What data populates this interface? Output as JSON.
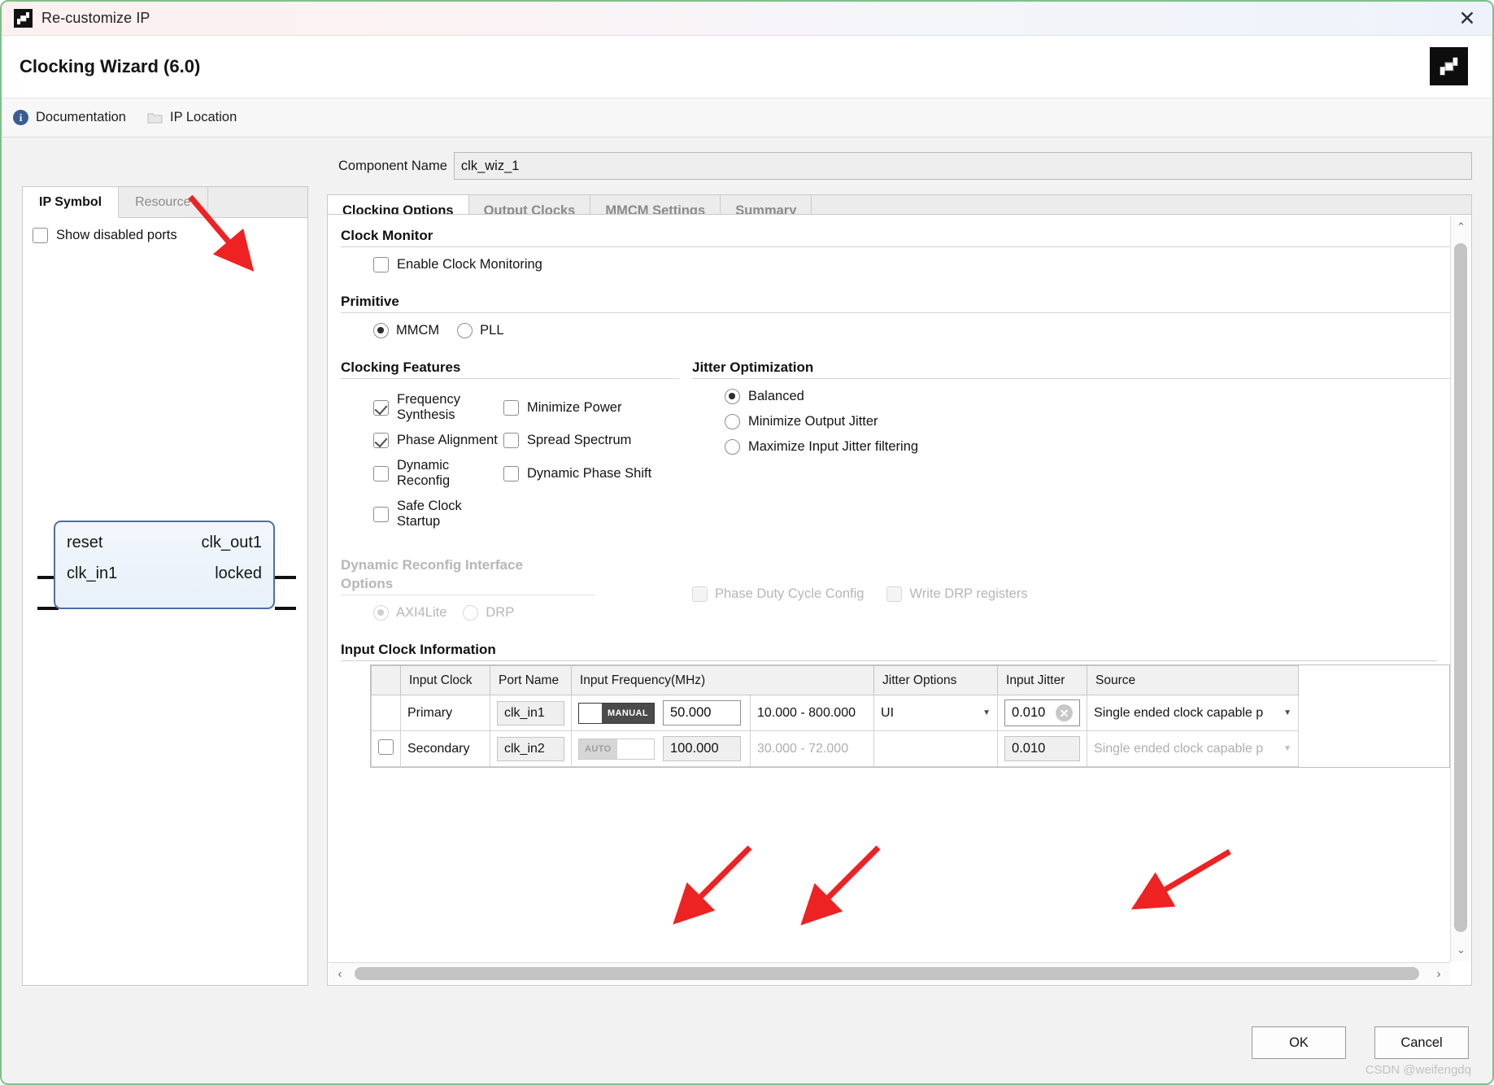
{
  "window": {
    "title": "Re-customize IP",
    "close_label": "✕",
    "logo_icon": "xilinx-logo-icon"
  },
  "header": {
    "title": "Clocking Wizard (6.0)",
    "vendor_logo_icon": "amd-xilinx-logo-icon"
  },
  "toolbar": {
    "documentation_label": "Documentation",
    "documentation_icon": "info-icon",
    "ip_location_label": "IP Location",
    "ip_location_icon": "folder-icon"
  },
  "left_panel": {
    "tabs": [
      {
        "label": "IP Symbol",
        "active": true
      },
      {
        "label": "Resource",
        "active": false
      }
    ],
    "show_disabled_ports": {
      "label": "Show disabled ports",
      "checked": false
    },
    "symbol": {
      "inputs": [
        "reset",
        "clk_in1"
      ],
      "outputs": [
        "clk_out1",
        "locked"
      ]
    }
  },
  "component": {
    "label": "Component Name",
    "value": "clk_wiz_1"
  },
  "tabs": [
    {
      "label": "Clocking Options",
      "active": true
    },
    {
      "label": "Output Clocks",
      "active": false
    },
    {
      "label": "MMCM Settings",
      "active": false
    },
    {
      "label": "Summary",
      "active": false
    }
  ],
  "sections": {
    "clock_monitor": {
      "title": "Clock Monitor",
      "enable_clock_monitoring": {
        "label": "Enable Clock Monitoring",
        "checked": false
      }
    },
    "primitive": {
      "title": "Primitive",
      "options": [
        {
          "label": "MMCM",
          "selected": true
        },
        {
          "label": "PLL",
          "selected": false
        }
      ]
    },
    "clocking_features": {
      "title": "Clocking Features",
      "items": [
        {
          "label": "Frequency Synthesis",
          "checked": true
        },
        {
          "label": "Minimize Power",
          "checked": false
        },
        {
          "label": "Phase Alignment",
          "checked": true
        },
        {
          "label": "Spread Spectrum",
          "checked": false
        },
        {
          "label": "Dynamic Reconfig",
          "checked": false
        },
        {
          "label": "Dynamic Phase Shift",
          "checked": false
        },
        {
          "label": "Safe Clock Startup",
          "checked": false
        }
      ]
    },
    "jitter_optimization": {
      "title": "Jitter Optimization",
      "options": [
        {
          "label": "Balanced",
          "selected": true
        },
        {
          "label": "Minimize Output Jitter",
          "selected": false
        },
        {
          "label": "Maximize Input Jitter filtering",
          "selected": false
        }
      ]
    },
    "dynamic_reconfig": {
      "title_line1": "Dynamic Reconfig Interface",
      "title_line2": "Options",
      "radios": [
        {
          "label": "AXI4Lite",
          "selected": true
        },
        {
          "label": "DRP",
          "selected": false
        }
      ],
      "checkboxes": [
        {
          "label": "Phase Duty Cycle Config",
          "checked": false
        },
        {
          "label": "Write DRP registers",
          "checked": false
        }
      ]
    },
    "input_clock_information": {
      "title": "Input Clock Information",
      "columns": [
        "",
        "Input Clock",
        "Port Name",
        "Input Frequency(MHz)",
        "",
        "Jitter Options",
        "Input Jitter",
        "Source"
      ],
      "rows": [
        {
          "enabled": true,
          "row_checkbox": false,
          "show_row_checkbox": false,
          "input_clock": "Primary",
          "port_name": "clk_in1",
          "toggle_label": "MANUAL",
          "toggle_state": "manual",
          "frequency": "50.000",
          "range": "10.000 - 800.000",
          "jitter_option": "UI",
          "input_jitter": "0.010",
          "source": "Single ended clock capable p"
        },
        {
          "enabled": false,
          "row_checkbox": false,
          "show_row_checkbox": true,
          "input_clock": "Secondary",
          "port_name": "clk_in2",
          "toggle_label": "AUTO",
          "toggle_state": "auto",
          "frequency": "100.000",
          "range": "30.000 - 72.000",
          "jitter_option": "",
          "input_jitter": "0.010",
          "source": "Single ended clock capable p"
        }
      ]
    }
  },
  "scrollbars": {
    "vertical_up": "⌃",
    "vertical_down": "⌄",
    "horizontal_left": "‹",
    "horizontal_right": "›"
  },
  "footer": {
    "ok_label": "OK",
    "cancel_label": "Cancel",
    "watermark": "CSDN @weifengdq"
  },
  "colors": {
    "accent_blue": "#4f6ea8",
    "toggle_on": "#4b4b4b",
    "annotation_red": "#ee2222"
  }
}
